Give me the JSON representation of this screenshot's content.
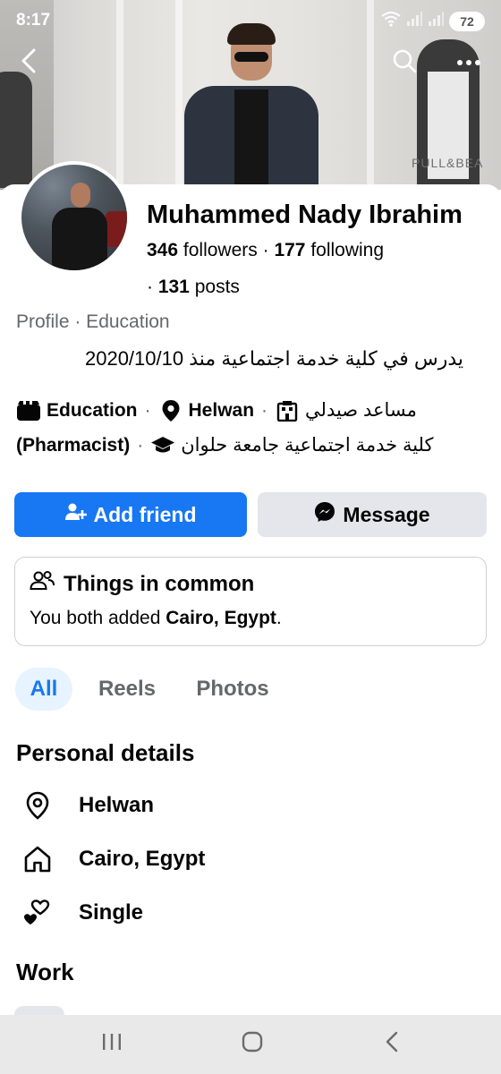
{
  "status_bar": {
    "time": "8:17",
    "battery": "72"
  },
  "cover": {
    "brand_text": "PULL&BEA"
  },
  "profile": {
    "name": "Muhammed Nady Ibrahim",
    "followers_count": "346",
    "followers_label": "followers",
    "following_count": "177",
    "following_label": "following",
    "posts_count": "131",
    "posts_label": "posts",
    "breadcrumb": "Profile · Education",
    "bio": "يدرس في كلية خدمة اجتماعية منذ 2020/10/10"
  },
  "details": {
    "education_label": "Education",
    "location": "Helwan",
    "job_title": "مساعد صيدلي",
    "job_title_en": "(Pharmacist)",
    "school": "كلية خدمة اجتماعية جامعة حلوان"
  },
  "actions": {
    "add_friend": "Add friend",
    "message": "Message"
  },
  "common": {
    "title": "Things in common",
    "text_prefix": "You both added ",
    "text_bold": "Cairo, Egypt",
    "text_suffix": "."
  },
  "tabs": {
    "all": "All",
    "reels": "Reels",
    "photos": "Photos",
    "active": "All"
  },
  "personal_details": {
    "title": "Personal details",
    "items": [
      {
        "icon": "location-pin-icon",
        "label": "Helwan"
      },
      {
        "icon": "home-icon",
        "label": "Cairo, Egypt"
      },
      {
        "icon": "hearts-icon",
        "label": "Single"
      }
    ]
  },
  "work": {
    "title": "Work"
  },
  "colors": {
    "accent": "#1877f2",
    "secondary_button": "#e4e6eb",
    "muted_text": "#65676b",
    "tab_active_bg": "#e7f3ff"
  },
  "icons": {
    "back": "back-arrow-icon",
    "search": "search-icon",
    "more": "more-icon",
    "add_friend": "add-friend-icon",
    "messenger": "messenger-icon",
    "common": "people-icon"
  }
}
